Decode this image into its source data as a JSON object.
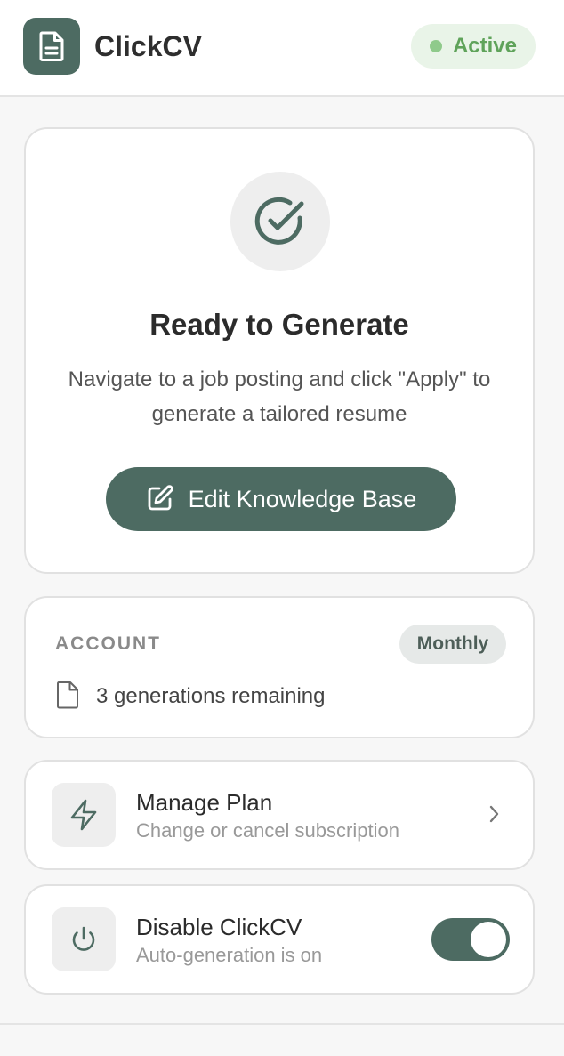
{
  "header": {
    "app_title": "ClickCV",
    "status_label": "Active",
    "logo_icon": "document-icon",
    "brand_color": "#4d6b62",
    "status_color": "#5fa35a"
  },
  "hero": {
    "icon": "check-circle-icon",
    "title": "Ready to Generate",
    "description": "Navigate to a job posting and click \"Apply\" to generate a tailored resume",
    "button_label": "Edit Knowledge Base",
    "button_icon": "edit-icon"
  },
  "account": {
    "section_label": "ACCOUNT",
    "plan_badge": "Monthly",
    "generations_text": "3 generations remaining",
    "generations_icon": "file-icon"
  },
  "manage_plan": {
    "title": "Manage Plan",
    "subtitle": "Change or cancel subscription",
    "icon": "lightning-icon"
  },
  "disable": {
    "title": "Disable ClickCV",
    "subtitle": "Auto-generation is on",
    "icon": "power-icon",
    "toggle_on": true
  }
}
